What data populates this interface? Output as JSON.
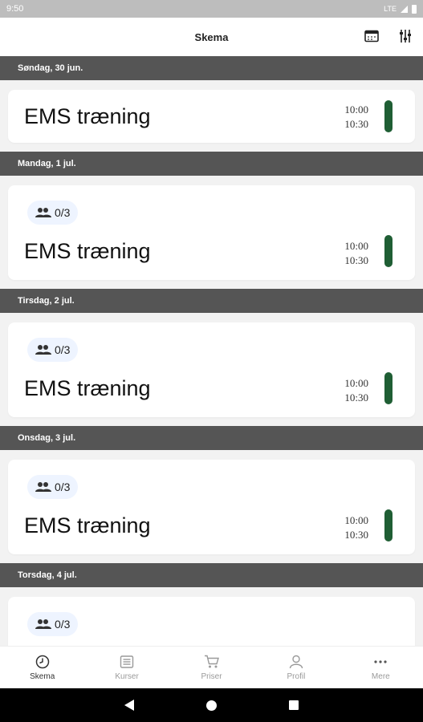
{
  "status_bar": {
    "time": "9:50",
    "network": "LTE"
  },
  "header": {
    "title": "Skema"
  },
  "days": [
    {
      "label": "Søndag, 30 jun.",
      "title": "EMS træning",
      "start": "10:00",
      "end": "10:30"
    },
    {
      "label": "Mandag, 1 jul.",
      "participants": "0/3",
      "title": "EMS træning",
      "start": "10:00",
      "end": "10:30"
    },
    {
      "label": "Tirsdag, 2 jul.",
      "participants": "0/3",
      "title": "EMS træning",
      "start": "10:00",
      "end": "10:30"
    },
    {
      "label": "Onsdag, 3 jul.",
      "participants": "0/3",
      "title": "EMS træning",
      "start": "10:00",
      "end": "10:30"
    },
    {
      "label": "Torsdag, 4 jul.",
      "participants": "0/3"
    }
  ],
  "bottom_nav": {
    "items": [
      {
        "label": "Skema",
        "icon": "clock-icon",
        "active": true
      },
      {
        "label": "Kurser",
        "icon": "list-icon",
        "active": false
      },
      {
        "label": "Priser",
        "icon": "cart-icon",
        "active": false
      },
      {
        "label": "Profil",
        "icon": "person-icon",
        "active": false
      },
      {
        "label": "Mere",
        "icon": "more-icon",
        "active": false
      }
    ]
  },
  "colors": {
    "accent_bar": "#1f5e34",
    "day_header_bg": "#555555",
    "badge_bg": "#eef4ff"
  }
}
